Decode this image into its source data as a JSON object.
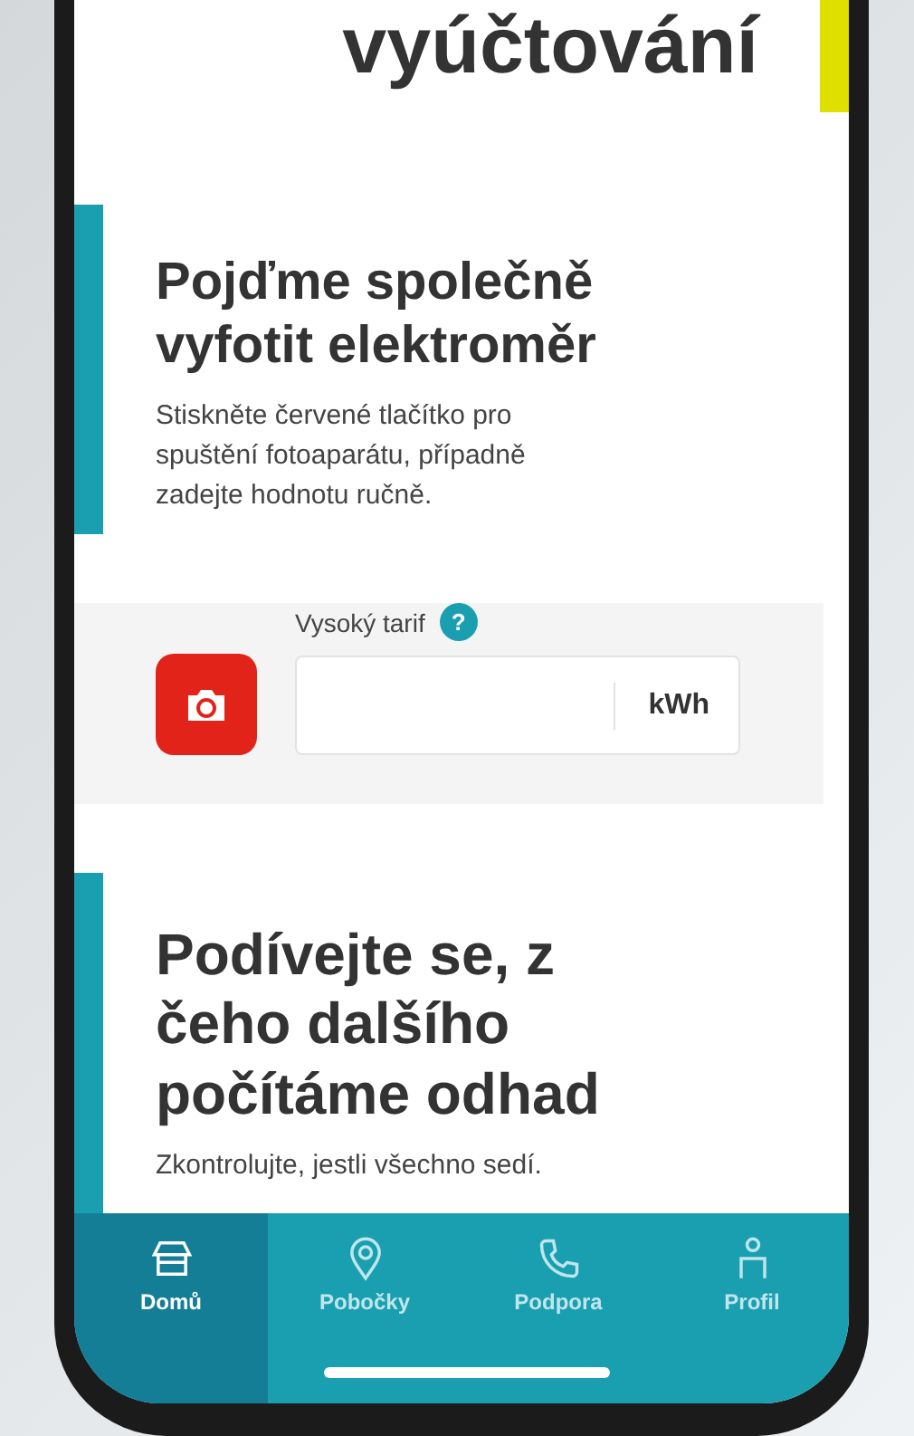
{
  "header": {
    "title": "vyúčtování"
  },
  "intro": {
    "heading": "Pojďme společně vyfotit elektroměr",
    "text": "Stiskněte červené tlačítko pro spuštění fotoaparátu, případně zadejte hodnotu ručně."
  },
  "meter": {
    "label": "Vysoký tarif",
    "help": "?",
    "unit": "kWh"
  },
  "estimate": {
    "heading": "Podívejte se, z čeho dalšího počítáme odhad",
    "text": "Zkontrolujte, jestli všechno sedí."
  },
  "nav": [
    {
      "label": "Domů",
      "selected": true
    },
    {
      "label": "Pobočky",
      "selected": false
    },
    {
      "label": "Podpora",
      "selected": false
    },
    {
      "label": "Profil",
      "selected": false
    }
  ]
}
